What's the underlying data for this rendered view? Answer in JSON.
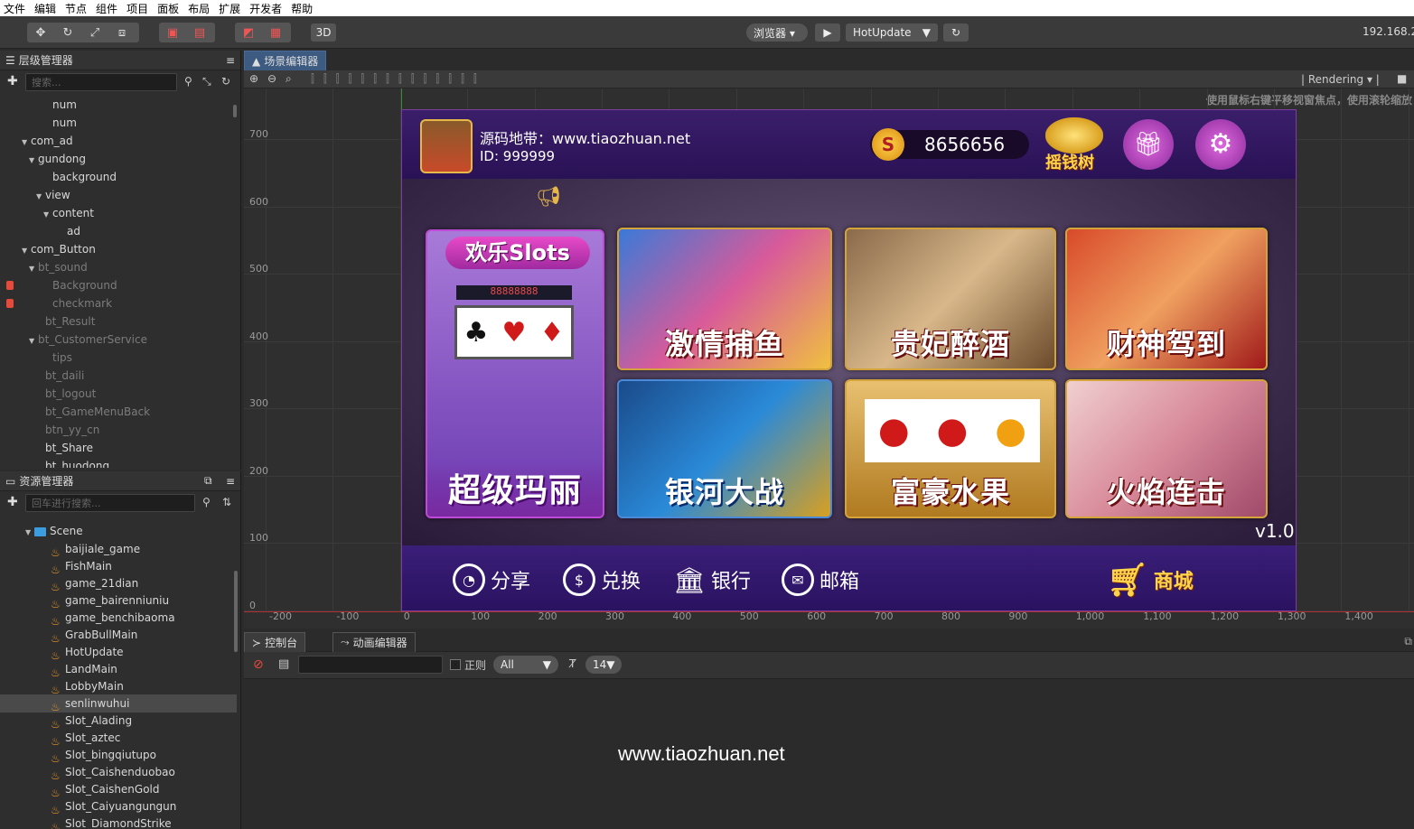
{
  "menu": [
    "文件",
    "编辑",
    "节点",
    "组件",
    "项目",
    "面板",
    "布局",
    "扩展",
    "开发者",
    "帮助"
  ],
  "toolbar": {
    "preview_mode": "浏览器 ▾",
    "scene_select": "HotUpdate",
    "ip": "192.168.2.",
    "btn3d": "3D"
  },
  "hierarchy": {
    "title": "层级管理器",
    "search_placeholder": "搜索...",
    "rows": [
      {
        "label": "num",
        "indent": 5,
        "dim": false,
        "arrow": ""
      },
      {
        "label": "num",
        "indent": 5,
        "dim": false,
        "arrow": ""
      },
      {
        "label": "com_ad",
        "indent": 2,
        "dim": false,
        "arrow": "▼"
      },
      {
        "label": "gundong",
        "indent": 3,
        "dim": false,
        "arrow": "▼"
      },
      {
        "label": "background",
        "indent": 5,
        "dim": false,
        "arrow": ""
      },
      {
        "label": "view",
        "indent": 4,
        "dim": false,
        "arrow": "▼"
      },
      {
        "label": "content",
        "indent": 5,
        "dim": false,
        "arrow": "▼"
      },
      {
        "label": "ad",
        "indent": 7,
        "dim": false,
        "arrow": ""
      },
      {
        "label": "com_Button",
        "indent": 2,
        "dim": false,
        "arrow": "▼"
      },
      {
        "label": "bt_sound",
        "indent": 3,
        "dim": true,
        "arrow": "▼"
      },
      {
        "label": "Background",
        "indent": 5,
        "dim": true,
        "arrow": "",
        "lock": true
      },
      {
        "label": "checkmark",
        "indent": 5,
        "dim": true,
        "arrow": "",
        "lock": true
      },
      {
        "label": "bt_Result",
        "indent": 4,
        "dim": true,
        "arrow": ""
      },
      {
        "label": "bt_CustomerService",
        "indent": 3,
        "dim": true,
        "arrow": "▼"
      },
      {
        "label": "tips",
        "indent": 5,
        "dim": true,
        "arrow": ""
      },
      {
        "label": "bt_daili",
        "indent": 4,
        "dim": true,
        "arrow": ""
      },
      {
        "label": "bt_logout",
        "indent": 4,
        "dim": true,
        "arrow": ""
      },
      {
        "label": "bt_GameMenuBack",
        "indent": 4,
        "dim": true,
        "arrow": ""
      },
      {
        "label": "btn_yy_cn",
        "indent": 4,
        "dim": true,
        "arrow": ""
      },
      {
        "label": "bt_Share",
        "indent": 4,
        "dim": false,
        "arrow": ""
      },
      {
        "label": "bt_huodong",
        "indent": 4,
        "dim": false,
        "arrow": ""
      }
    ]
  },
  "assets": {
    "title": "资源管理器",
    "search_placeholder": "回车进行搜索...",
    "folder": "Scene",
    "items": [
      "baijiale_game",
      "FishMain",
      "game_21dian",
      "game_bairenniuniu",
      "game_benchibaoma",
      "GrabBullMain",
      "HotUpdate",
      "LandMain",
      "LobbyMain",
      "senlinwuhui",
      "Slot_Alading",
      "Slot_aztec",
      "Slot_bingqiutupo",
      "Slot_Caishenduobao",
      "Slot_CaishenGold",
      "Slot_Caiyuangungun",
      "Slot_DiamondStrike"
    ],
    "selected": "senlinwuhui"
  },
  "scene": {
    "tab": "场景编辑器",
    "rendering": "Rendering",
    "hint": "使用鼠标右键平移视窗焦点，使用滚轮缩放",
    "y_ticks": [
      "700",
      "600",
      "500",
      "400",
      "300",
      "200",
      "100",
      "0"
    ],
    "x_ticks": [
      "-200",
      "-100",
      "0",
      "100",
      "200",
      "300",
      "400",
      "500",
      "600",
      "700",
      "800",
      "900",
      "1,000",
      "1,100",
      "1,200",
      "1,300",
      "1,400"
    ]
  },
  "game": {
    "site": "源码地带：www.tiaozhuan.net",
    "id": "ID: 999999",
    "coins": "8656656",
    "tree_label": "摇钱树",
    "version": "v1.0",
    "slot_title": "欢乐Slots",
    "slot_counter": "88888888",
    "cards": [
      "超级玛丽",
      "激情捕鱼",
      "贵妃醉酒",
      "财神驾到",
      "银河大战",
      "富豪水果",
      "火焰连击"
    ],
    "bottom": [
      "分享",
      "兑换",
      "银行",
      "邮箱"
    ],
    "shop": "商城"
  },
  "console": {
    "tabs": [
      "控制台",
      "动画编辑器"
    ],
    "regex": "正则",
    "level": "All",
    "fontsize": "14"
  },
  "watermark": "www.tiaozhuan.net"
}
